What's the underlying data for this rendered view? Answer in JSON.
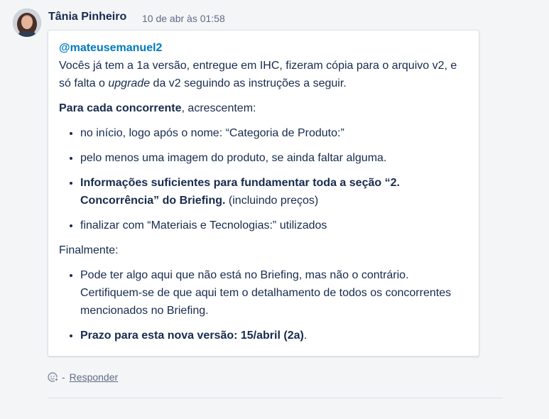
{
  "comment": {
    "author": "Tânia Pinheiro",
    "timestamp": "10 de abr às 01:58",
    "mention": "@mateusemanuel2",
    "intro_1": "Vocês já tem a 1a versão, entregue em IHC, fizeram cópia para o arquivo v2, e só falta o ",
    "intro_italic": "upgrade",
    "intro_2": " da v2 seguindo as instruções a seguir.",
    "section1_bold": "Para cada concorrente",
    "section1_rest": ", acrescentem:",
    "list1": [
      "no início, logo após o nome: “Categoria de Produto:”",
      "pelo menos uma imagem do produto, se ainda faltar alguma.",
      {
        "bold": "Informações suficientes para fundamentar toda a seção “2. Concorrência” do Briefing.",
        "rest": " (incluindo preços)"
      },
      "finalizar com “Materiais e Tecnologias:” utilizados"
    ],
    "section2": "Finalmente:",
    "list2_item1": "Pode ter algo aqui que não está no Briefing, mas não o contrário. Certifiquem-se de que aqui tem o detalhamento de todos os concorrentes mencionados no Briefing.",
    "list2_item2_bold": "Prazo para esta nova versão: 15/abril (2a)",
    "list2_item2_rest": "."
  },
  "footer": {
    "separator": "-",
    "reply_label": "Responder",
    "reaction_icon": "add-reaction-icon"
  },
  "colors": {
    "background": "#f4f5f7",
    "mention": "#0079bf",
    "text": "#172b4d",
    "meta": "#5e6c84"
  }
}
